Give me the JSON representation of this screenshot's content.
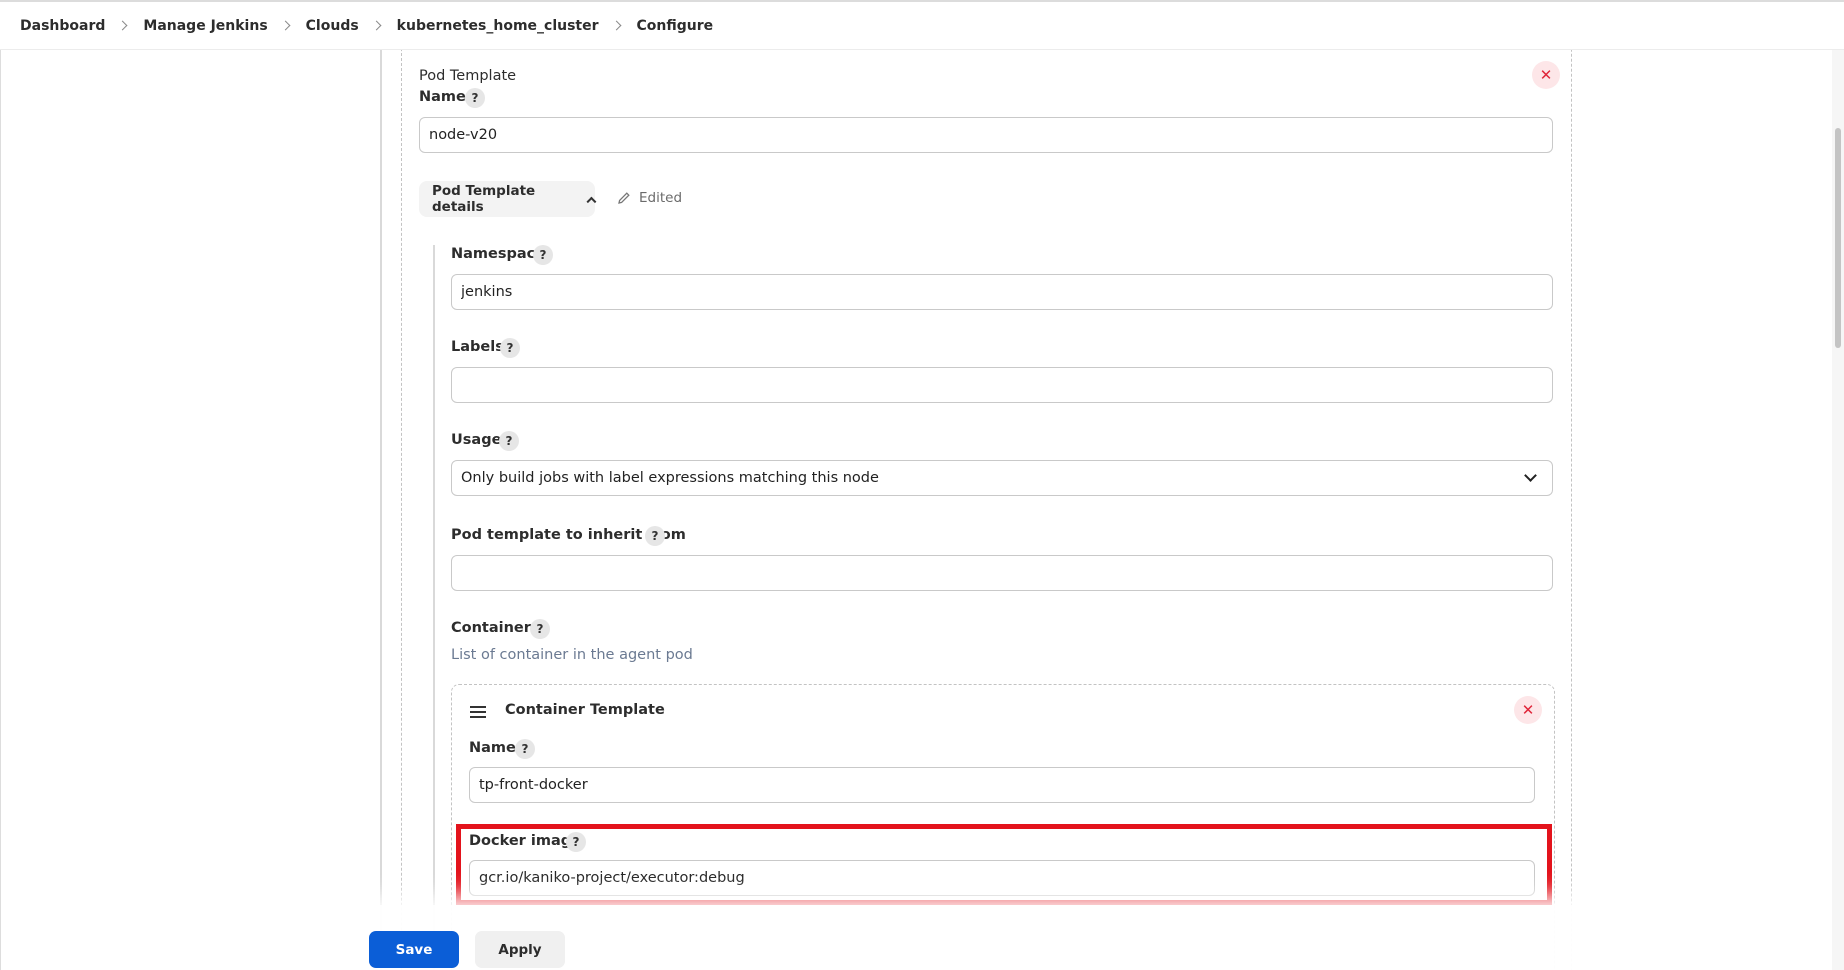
{
  "breadcrumb": [
    "Dashboard",
    "Manage Jenkins",
    "Clouds",
    "kubernetes_home_cluster",
    "Configure"
  ],
  "pod_template": {
    "heading": "Pod Template",
    "name_label": "Name",
    "name_value": "node-v20",
    "details_button": "Pod Template details",
    "edited_label": "Edited",
    "namespace_label": "Namespace",
    "namespace_value": "jenkins",
    "labels_label": "Labels",
    "labels_value": "",
    "usage_label": "Usage",
    "usage_value": "Only build jobs with label expressions matching this node",
    "inherit_label": "Pod template to inherit from",
    "inherit_value": "",
    "containers_label": "Containers",
    "containers_description": "List of container in the agent pod"
  },
  "container_template": {
    "heading": "Container Template",
    "name_label": "Name",
    "name_value": "tp-front-docker",
    "docker_image_label": "Docker image",
    "docker_image_value": "gcr.io/kaniko-project/executor:debug"
  },
  "help_glyph": "?",
  "close_glyph": "✕",
  "actions": {
    "save": "Save",
    "apply": "Apply"
  },
  "colors": {
    "primary": "#0b5ed7",
    "highlight": "#e3131c",
    "close": "#e0263a"
  },
  "icons": [
    "chevron-right-icon",
    "close-icon",
    "chevron-up-icon",
    "pencil-icon",
    "chevron-down-icon",
    "drag-handle-icon",
    "help-icon"
  ]
}
